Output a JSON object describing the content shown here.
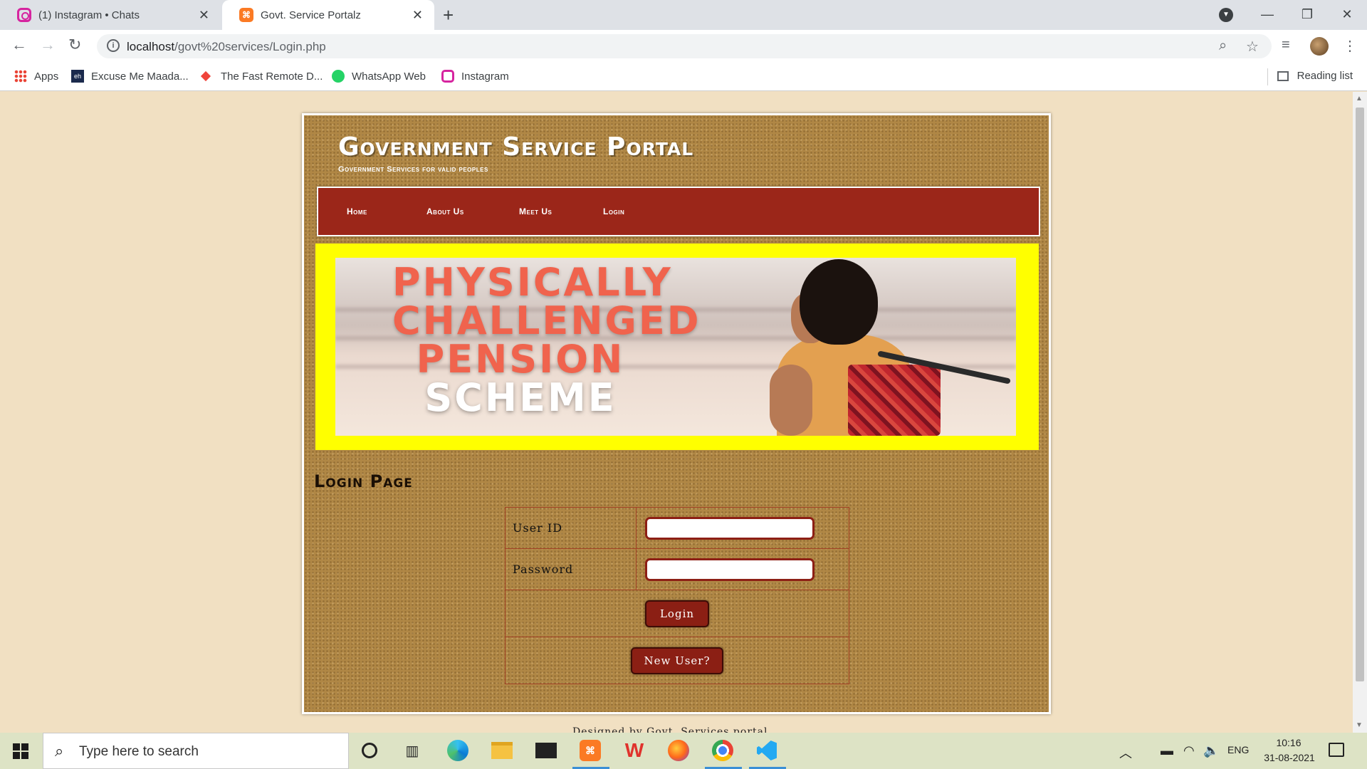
{
  "browser": {
    "tabs": [
      {
        "title": "(1) Instagram • Chats",
        "icon": "instagram-icon"
      },
      {
        "title": "Govt. Service Portalz",
        "icon": "xampp-icon"
      }
    ],
    "new_tab": "+",
    "url_host": "localhost",
    "url_path": "/govt%20services/Login.php",
    "bookmarks": [
      {
        "label": "Apps",
        "icon": "apps-grid-icon"
      },
      {
        "label": "Excuse Me Maada...",
        "icon": "eh-icon"
      },
      {
        "label": "The Fast Remote D...",
        "icon": "anydesk-icon"
      },
      {
        "label": "WhatsApp Web",
        "icon": "whatsapp-icon"
      },
      {
        "label": "Instagram",
        "icon": "instagram-icon"
      }
    ],
    "reading_list": "Reading list"
  },
  "site": {
    "title": "Government Service Portal",
    "subtitle": "Government Services for valid peoples",
    "nav": [
      "Home",
      "About Us",
      "Meet Us",
      "Login"
    ],
    "banner": {
      "line1": "PHYSICALLY",
      "line2": "CHALLENGED",
      "line3": "PENSION",
      "line4": "SCHEME"
    },
    "login_heading": "Login Page",
    "form": {
      "user_id_label": "User ID",
      "password_label": "Password",
      "user_id_value": "",
      "password_value": "",
      "login_button": "Login",
      "new_user_button": "New User?"
    },
    "footer": "Designed by Govt. Services portal"
  },
  "colors": {
    "nav_bg": "#9b2619",
    "banner_frame": "#ffff00",
    "page_bg": "#f1e0c2",
    "button_bg": "#8b1f14"
  },
  "taskbar": {
    "search_placeholder": "Type here to search",
    "apps": [
      "cortana-icon",
      "task-view-icon",
      "edge-icon",
      "file-explorer-icon",
      "mail-icon",
      "xampp-icon",
      "wps-icon",
      "firefox-icon",
      "chrome-icon",
      "vscode-icon"
    ],
    "language": "ENG",
    "time": "10:16",
    "date": "31-08-2021"
  }
}
